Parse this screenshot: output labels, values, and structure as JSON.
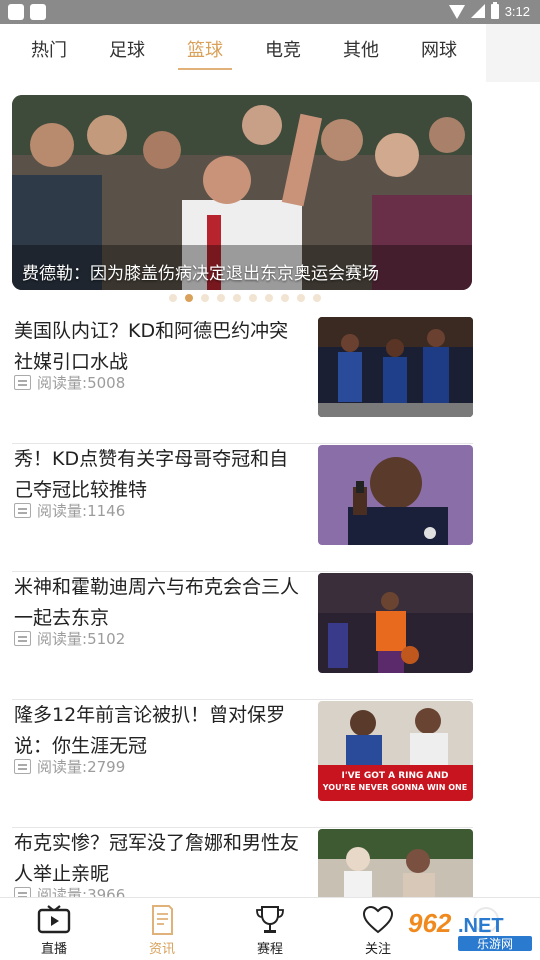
{
  "status_bar": {
    "time": "3:12"
  },
  "tabs": [
    {
      "label": "热门",
      "active": false
    },
    {
      "label": "足球",
      "active": false
    },
    {
      "label": "篮球",
      "active": true
    },
    {
      "label": "电竞",
      "active": false
    },
    {
      "label": "其他",
      "active": false
    },
    {
      "label": "网球",
      "active": false
    }
  ],
  "banner": {
    "caption": "费德勒：因为膝盖伤病决定退出东京奥运会赛场",
    "dot_count": 10,
    "active_dot": 1
  },
  "news": [
    {
      "title": "美国队内讧？KD和阿德巴约冲突社媒引口水战",
      "read_label": "阅读量:",
      "reads": "5008"
    },
    {
      "title": "秀！KD点赞有关字母哥夺冠和自己夺冠比较推特",
      "read_label": "阅读量:",
      "reads": "1146"
    },
    {
      "title": "米神和霍勒迪周六与布克会合三人一起去东京",
      "read_label": "阅读量:",
      "reads": "5102"
    },
    {
      "title": "隆多12年前言论被扒！曾对保罗说：你生涯无冠",
      "read_label": "阅读量:",
      "reads": "2799",
      "image_text_1": "I'VE GOT A RING AND",
      "image_text_2": "YOU'RE NEVER GONNA WIN ONE"
    },
    {
      "title": "布克实惨？冠军没了詹娜和男性友人举止亲昵",
      "read_label": "阅读量:",
      "reads": "3966"
    }
  ],
  "bottom_nav": [
    {
      "label": "直播",
      "icon": "tv-play-icon",
      "active": false
    },
    {
      "label": "资讯",
      "icon": "news-doc-icon",
      "active": true
    },
    {
      "label": "赛程",
      "icon": "trophy-icon",
      "active": false
    },
    {
      "label": "关注",
      "icon": "heart-icon",
      "active": false
    }
  ],
  "watermark": {
    "number": "962",
    "suffix": ".NET",
    "name": "乐游网"
  },
  "colors": {
    "accent": "#d9a15a",
    "statusbar": "#8a8a8a",
    "text": "#222222",
    "muted": "#9c9c9c"
  }
}
